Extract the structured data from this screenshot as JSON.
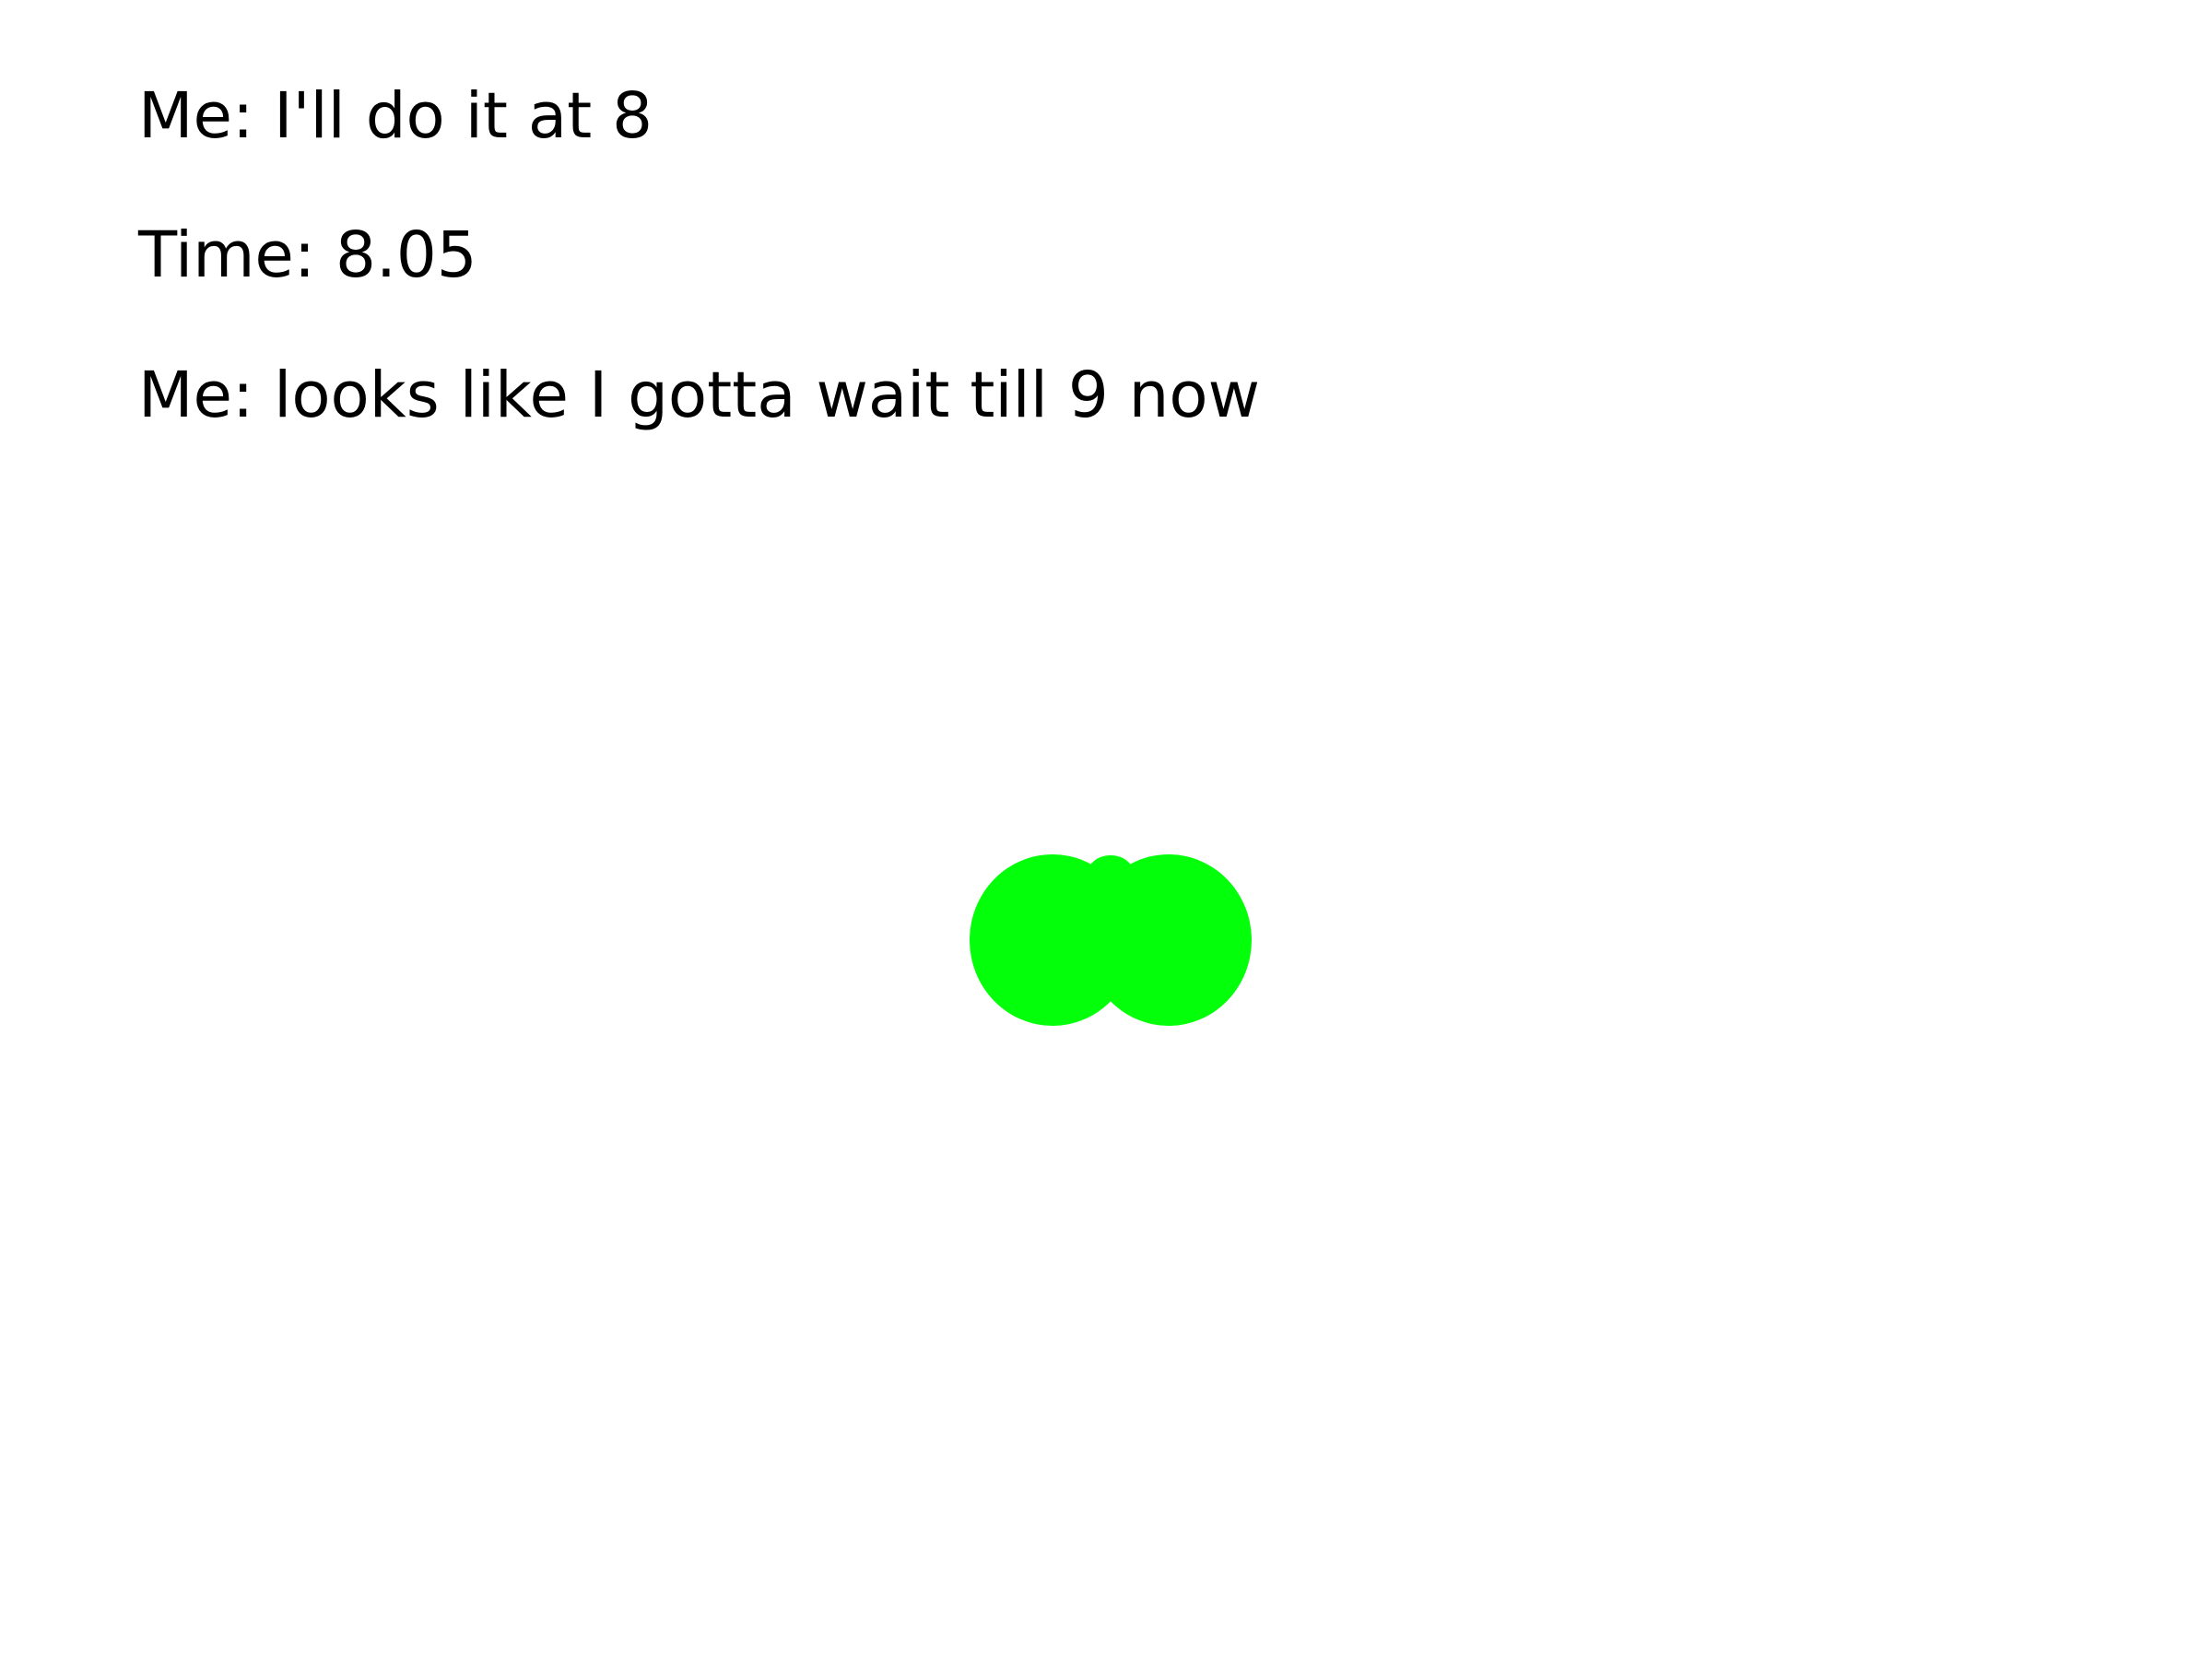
{
  "meme": {
    "lines": [
      "Me: I'll do it at 8",
      "Time: 8.05",
      "Me: looks like I gotta wait till 9 now"
    ]
  },
  "colors": {
    "background": "#ffffff",
    "text": "#000000",
    "blob": "#04ff0a"
  },
  "icons": {
    "blob": "green-blob-icon"
  }
}
